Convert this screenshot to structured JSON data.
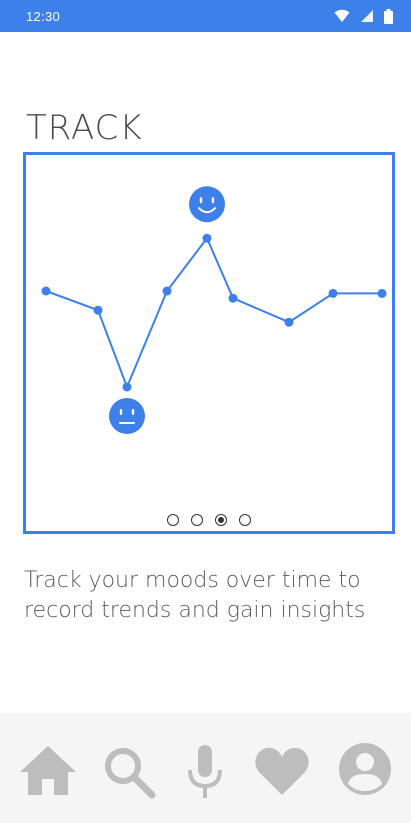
{
  "status_bar": {
    "time": "12:30",
    "icons": [
      "wifi-icon",
      "cell-signal-icon",
      "battery-icon"
    ]
  },
  "onboarding": {
    "title": "TRACK",
    "description": "Track your moods over time to record trends and gain insights",
    "page_count": 4,
    "active_page": 3
  },
  "chart_data": {
    "type": "line",
    "title": "",
    "xlabel": "",
    "ylabel": "",
    "x": [
      1,
      2,
      3,
      4,
      5,
      6,
      7,
      8,
      9
    ],
    "series": [
      {
        "values": [
          60,
          52,
          20,
          60,
          82,
          57,
          47,
          59,
          59
        ]
      }
    ],
    "ylim": [
      0,
      100
    ],
    "grid": false,
    "legend": "none",
    "annotations": [
      {
        "icon": "happy-face-icon",
        "at_point": 5
      },
      {
        "icon": "neutral-face-icon",
        "at_point": 3
      }
    ]
  },
  "colors": {
    "accent": "#3e80ea",
    "nav_icon": "#bdbdbd",
    "nav_background": "#f5f5f5"
  },
  "bottom_nav": {
    "items": [
      {
        "icon": "home-icon"
      },
      {
        "icon": "search-icon"
      },
      {
        "icon": "microphone-icon"
      },
      {
        "icon": "heart-icon"
      },
      {
        "icon": "profile-icon"
      }
    ]
  }
}
